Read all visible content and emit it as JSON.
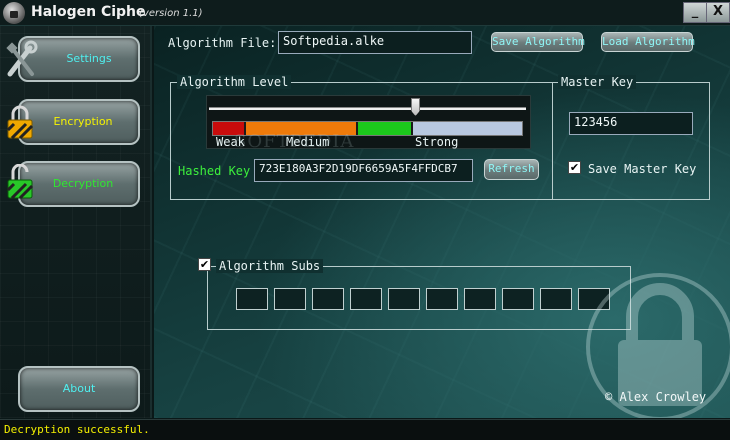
{
  "window": {
    "title": "Halogen Ciphe",
    "version": "(version 1.1)",
    "minimize_glyph": "_",
    "close_glyph": "X"
  },
  "sidebar": {
    "items": [
      {
        "label": "Settings",
        "icon": "tools-icon",
        "color": "#4ff0f0"
      },
      {
        "label": "Encryption",
        "icon": "padlock-locked-icon",
        "color": "#f7f400"
      },
      {
        "label": "Decryption",
        "icon": "padlock-unlocked-icon",
        "color": "#30e830"
      },
      {
        "label": "About",
        "color": "#4ff0f0"
      }
    ]
  },
  "algorithm_file": {
    "label": "Algorithm File:",
    "value": "Softpedia.alke",
    "save_button": "Save Algorithm",
    "load_button": "Load Algorithm"
  },
  "algorithm_level": {
    "title": "Algorithm Level",
    "slider_value_fraction": 0.65,
    "labels": {
      "weak": "Weak",
      "medium": "Medium",
      "strong": "Strong"
    },
    "colors": {
      "weak": "#c80c0c",
      "medium": "#ee7a0a",
      "strong": "#1cc81c",
      "rest": "#b8c8e0"
    },
    "hashed_key_label": "Hashed Key",
    "hashed_key_value": "723E180A3F2D19DF6659A5F4FFDCB7",
    "refresh_button": "Refresh"
  },
  "master_key": {
    "title": "Master Key",
    "value": "123456",
    "save_checkbox_label": "Save Master Key",
    "save_checked": true
  },
  "algorithm_subs": {
    "title": "Algorithm Subs",
    "checked": true,
    "cells": [
      "",
      "",
      "",
      "",
      "",
      "",
      "",
      "",
      "",
      ""
    ]
  },
  "watermark": "SOFTPEDIA",
  "copyright": "© Alex Crowley",
  "status": "Decryption successful."
}
